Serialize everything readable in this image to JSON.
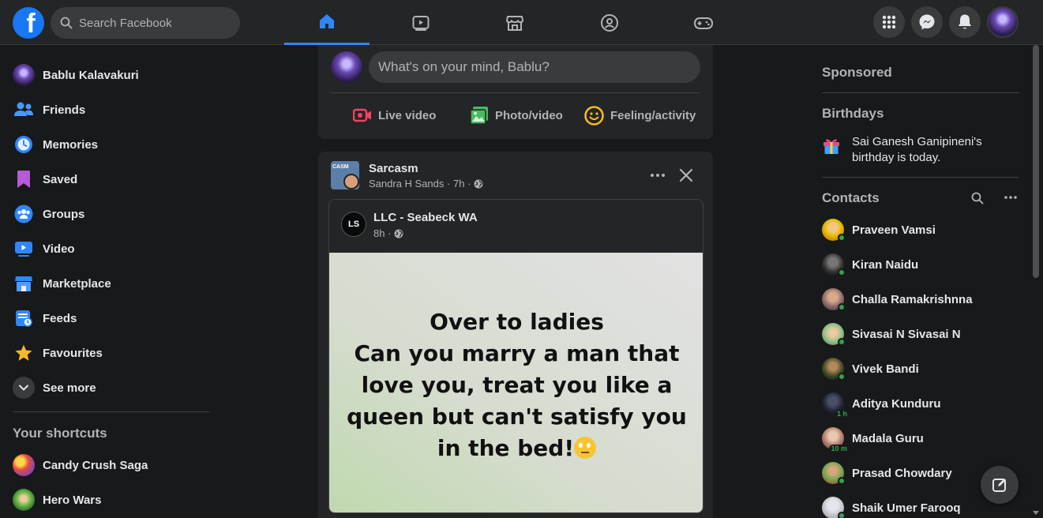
{
  "topbar": {
    "logo": "f",
    "search_placeholder": "Search Facebook",
    "nav_tabs": [
      "home-icon",
      "watch-icon",
      "marketplace-icon",
      "groups-icon",
      "gaming-icon"
    ],
    "right_icons": [
      "menu-grid-icon",
      "messenger-icon",
      "notifications-icon",
      "account-avatar"
    ],
    "accent_color": "#2d88ff"
  },
  "left": {
    "items": [
      {
        "label": "Bablu Kalavakuri",
        "icon": "profile-avatar"
      },
      {
        "label": "Friends",
        "icon": "friends-icon"
      },
      {
        "label": "Memories",
        "icon": "memories-icon"
      },
      {
        "label": "Saved",
        "icon": "saved-icon"
      },
      {
        "label": "Groups",
        "icon": "groups-icon"
      },
      {
        "label": "Video",
        "icon": "video-icon"
      },
      {
        "label": "Marketplace",
        "icon": "marketplace-icon"
      },
      {
        "label": "Feeds",
        "icon": "feeds-icon"
      },
      {
        "label": "Favourites",
        "icon": "star-icon"
      },
      {
        "label": "See more",
        "icon": "chevron-down-icon"
      }
    ],
    "shortcuts_title": "Your shortcuts",
    "shortcuts": [
      {
        "label": "Candy Crush Saga"
      },
      {
        "label": "Hero Wars"
      }
    ]
  },
  "composer": {
    "placeholder": "What's on your mind, Bablu?",
    "actions": [
      {
        "label": "Live video",
        "icon": "live-video-icon",
        "color": "#f3425f"
      },
      {
        "label": "Photo/video",
        "icon": "photo-icon",
        "color": "#45bd62"
      },
      {
        "label": "Feeling/activity",
        "icon": "feeling-icon",
        "color": "#f7b928"
      }
    ]
  },
  "post": {
    "page_name": "Sarcasm",
    "avatar_text": "CASM",
    "author": "Sandra H Sands",
    "time": "7h",
    "shared": {
      "page_name": "LLC - Seabeck WA",
      "avatar_text": "LS",
      "time": "8h",
      "quote_lines": [
        "Over to ladies",
        "Can you marry a man that",
        "love you, treat you like a",
        "queen but can't satisfy you",
        "in the bed!"
      ]
    }
  },
  "right": {
    "sponsored_title": "Sponsored",
    "birthdays_title": "Birthdays",
    "birthday_text": "Sai Ganesh Ganipineni's birthday is today.",
    "contacts_title": "Contacts",
    "contacts": [
      {
        "name": "Praveen Vamsi",
        "status": "online",
        "ago": ""
      },
      {
        "name": "Kiran Naidu",
        "status": "online",
        "ago": ""
      },
      {
        "name": "Challa Ramakrishnna",
        "status": "online",
        "ago": ""
      },
      {
        "name": "Sivasai N Sivasai N",
        "status": "online",
        "ago": ""
      },
      {
        "name": "Vivek Bandi",
        "status": "online",
        "ago": ""
      },
      {
        "name": "Aditya Kunduru",
        "status": "away",
        "ago": "1 h"
      },
      {
        "name": "Madala Guru",
        "status": "away",
        "ago": "10 m"
      },
      {
        "name": "Prasad Chowdary",
        "status": "online",
        "ago": ""
      },
      {
        "name": "Shaik Umer Farooq",
        "status": "online",
        "ago": ""
      }
    ]
  }
}
